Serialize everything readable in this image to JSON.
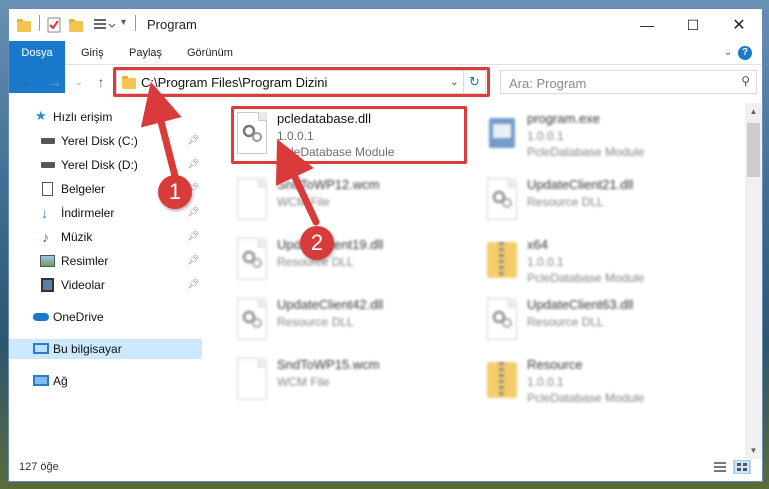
{
  "window": {
    "title": "Program"
  },
  "ribbon": {
    "tabs": [
      "Dosya",
      "Giriş",
      "Paylaş",
      "Görünüm"
    ],
    "help": "?"
  },
  "address": {
    "path": "C:\\Program Files\\Program Dizini",
    "search_placeholder": "Ara: Program"
  },
  "sidebar": {
    "items": [
      {
        "label": "Hızlı erişim",
        "icon": "star-icon",
        "pinned": false
      },
      {
        "label": "Yerel Disk (C:)",
        "icon": "drive-icon",
        "pinned": true
      },
      {
        "label": "Yerel Disk (D:)",
        "icon": "drive-icon",
        "pinned": true
      },
      {
        "label": "Belgeler",
        "icon": "document-icon",
        "pinned": true
      },
      {
        "label": "İndirmeler",
        "icon": "download-icon",
        "pinned": true
      },
      {
        "label": "Müzik",
        "icon": "music-icon",
        "pinned": true
      },
      {
        "label": "Resimler",
        "icon": "pictures-icon",
        "pinned": true
      },
      {
        "label": "Videolar",
        "icon": "video-icon",
        "pinned": true
      },
      {
        "label": "OneDrive",
        "icon": "cloud-icon",
        "pinned": false
      },
      {
        "label": "Bu bilgisayar",
        "icon": "computer-icon",
        "pinned": false
      },
      {
        "label": "Ağ",
        "icon": "network-icon",
        "pinned": false
      }
    ]
  },
  "files": [
    {
      "name": "pcledatabase.dll",
      "line1": "1.0.0.1",
      "line2": "PcleDatabase Module",
      "icon": "dll-gear-icon"
    },
    {
      "name": "program.exe",
      "line1": "1.0.0.1",
      "line2": "PcleDatabase Module",
      "icon": "exe-icon"
    },
    {
      "name": "SndToWP12.wcm",
      "line1": "WCM File",
      "line2": "",
      "icon": "blank-file-icon"
    },
    {
      "name": "UpdateClient21.dll",
      "line1": "Resource DLL",
      "line2": "",
      "icon": "dll-gear-icon"
    },
    {
      "name": "UpdateClient19.dll",
      "line1": "Resource DLL",
      "line2": "",
      "icon": "dll-gear-icon"
    },
    {
      "name": "x64",
      "line1": "1.0.0.1",
      "line2": "PcleDatabase Module",
      "icon": "zip-folder-icon"
    },
    {
      "name": "UpdateClient42.dll",
      "line1": "Resource DLL",
      "line2": "",
      "icon": "dll-gear-icon"
    },
    {
      "name": "UpdateClient63.dll",
      "line1": "Resource DLL",
      "line2": "",
      "icon": "dll-gear-icon"
    },
    {
      "name": "SndToWP15.wcm",
      "line1": "WCM File",
      "line2": "",
      "icon": "blank-file-icon"
    },
    {
      "name": "Resource",
      "line1": "1.0.0.1",
      "line2": "PcleDatabase Module",
      "icon": "zip-folder-icon"
    }
  ],
  "status": {
    "item_count": "127 öğe"
  },
  "markers": [
    "1",
    "2"
  ],
  "colors": {
    "accent": "#1979ca",
    "highlight": "#dc3b3b",
    "selected": "#cce8ff"
  }
}
